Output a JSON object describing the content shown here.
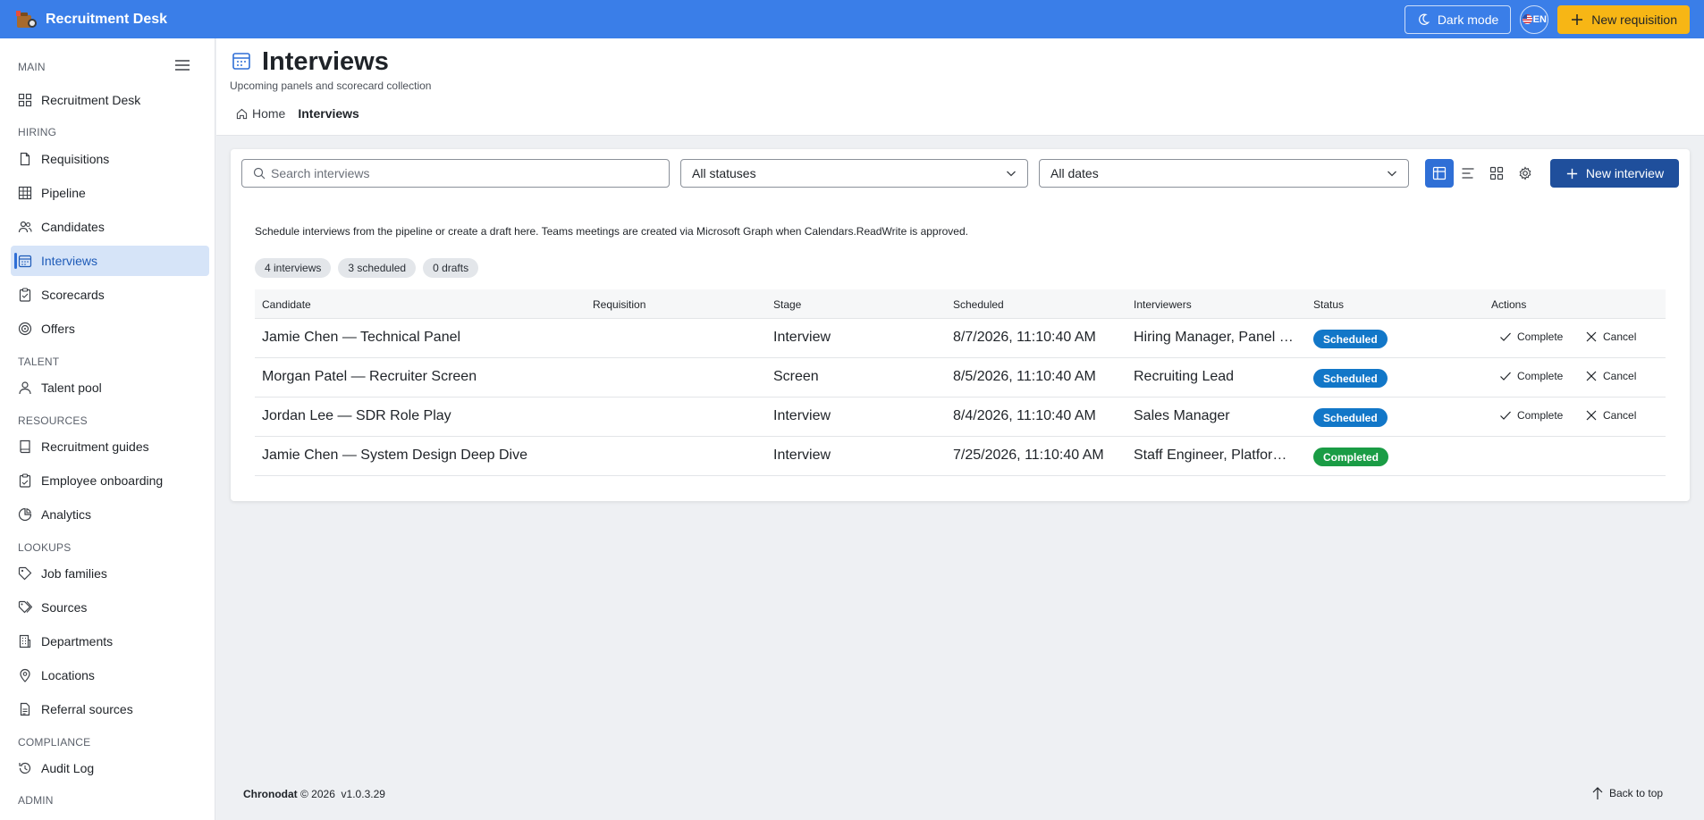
{
  "app": {
    "title": "Recruitment Desk",
    "dark_mode_label": "Dark mode",
    "lang_code": "EN",
    "new_requisition_label": "New requisition",
    "accent": "#3a7ee8"
  },
  "sidebar": {
    "sections": {
      "main": "MAIN",
      "hiring": "HIRING",
      "talent": "TALENT",
      "resources": "RESOURCES",
      "lookups": "LOOKUPS",
      "compliance": "COMPLIANCE",
      "admin": "ADMIN"
    },
    "items": [
      {
        "label": "Recruitment Desk",
        "icon": "dashboard-icon"
      },
      {
        "label": "Requisitions",
        "icon": "document-icon"
      },
      {
        "label": "Pipeline",
        "icon": "table-icon"
      },
      {
        "label": "Candidates",
        "icon": "people-icon"
      },
      {
        "label": "Interviews",
        "icon": "calendar-icon",
        "active": true
      },
      {
        "label": "Scorecards",
        "icon": "clipboard-icon"
      },
      {
        "label": "Offers",
        "icon": "target-icon"
      },
      {
        "label": "Talent pool",
        "icon": "person-icon"
      },
      {
        "label": "Recruitment guides",
        "icon": "book-icon"
      },
      {
        "label": "Employee onboarding",
        "icon": "clipboard-check-icon"
      },
      {
        "label": "Analytics",
        "icon": "analytics-icon"
      },
      {
        "label": "Job families",
        "icon": "tag-icon"
      },
      {
        "label": "Sources",
        "icon": "tags-icon"
      },
      {
        "label": "Departments",
        "icon": "building-icon"
      },
      {
        "label": "Locations",
        "icon": "location-icon"
      },
      {
        "label": "Referral sources",
        "icon": "document-text-icon"
      },
      {
        "label": "Audit Log",
        "icon": "history-icon"
      }
    ]
  },
  "page": {
    "title": "Interviews",
    "subtitle": "Upcoming panels and scorecard collection",
    "breadcrumb": {
      "home": "Home",
      "current": "Interviews"
    }
  },
  "toolbar": {
    "search_placeholder": "Search interviews",
    "status_filter": "All statuses",
    "date_filter": "All dates",
    "new_interview_label": "New interview"
  },
  "info_text": "Schedule interviews from the pipeline or create a draft here. Teams meetings are created via Microsoft Graph when Calendars.ReadWrite is approved.",
  "summary": {
    "interviews": "4 interviews",
    "scheduled": "3 scheduled",
    "drafts": "0 drafts"
  },
  "table": {
    "columns": {
      "candidate": "Candidate",
      "requisition": "Requisition",
      "stage": "Stage",
      "scheduled": "Scheduled",
      "interviewers": "Interviewers",
      "status": "Status",
      "actions": "Actions"
    },
    "rows": [
      {
        "candidate": "Jamie Chen — Technical Panel",
        "requisition": "",
        "stage": "Interview",
        "scheduled": "8/7/2026, 11:10:40 AM",
        "interviewers": "Hiring Manager, Panel Lead",
        "status": "Scheduled",
        "complete": "Complete",
        "cancel": "Cancel"
      },
      {
        "candidate": "Morgan Patel — Recruiter Screen",
        "requisition": "",
        "stage": "Screen",
        "scheduled": "8/5/2026, 11:10:40 AM",
        "interviewers": "Recruiting Lead",
        "status": "Scheduled",
        "complete": "Complete",
        "cancel": "Cancel"
      },
      {
        "candidate": "Jordan Lee — SDR Role Play",
        "requisition": "",
        "stage": "Interview",
        "scheduled": "8/4/2026, 11:10:40 AM",
        "interviewers": "Sales Manager",
        "status": "Scheduled",
        "complete": "Complete",
        "cancel": "Cancel"
      },
      {
        "candidate": "Jamie Chen — System Design Deep Dive",
        "requisition": "",
        "stage": "Interview",
        "scheduled": "7/25/2026, 11:10:40 AM",
        "interviewers": "Staff Engineer, Platform Lead",
        "status": "Completed"
      }
    ]
  },
  "footer": {
    "brand": "Chronodat",
    "copyright": "© 2026",
    "version": "v1.0.3.29",
    "back_to_top": "Back to top"
  }
}
